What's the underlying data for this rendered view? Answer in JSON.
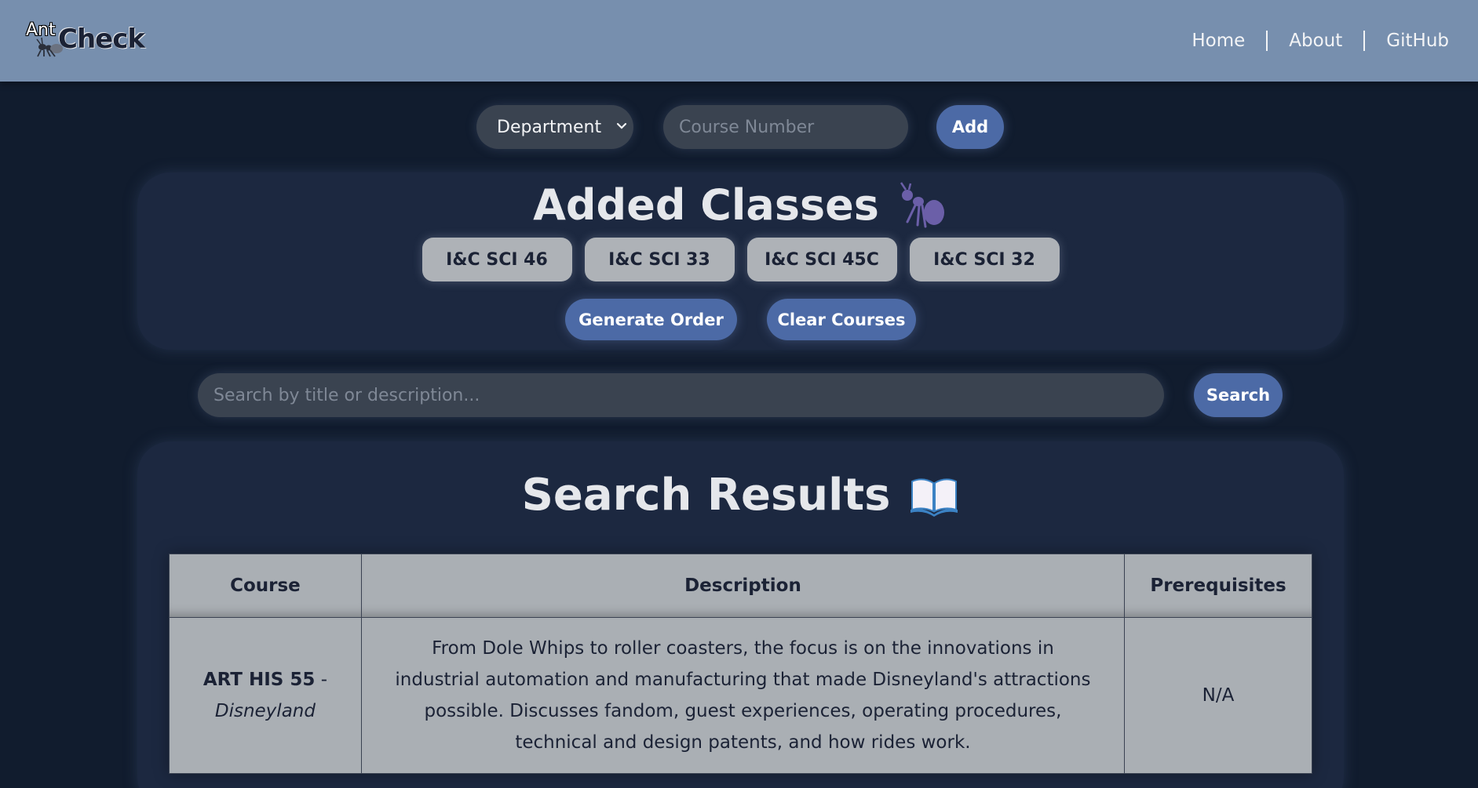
{
  "navbar": {
    "logo": {
      "ant_text": "Ant",
      "check_text": "Check"
    },
    "links": [
      "Home",
      "About",
      "GitHub"
    ]
  },
  "add_course": {
    "department_selected": "Department",
    "course_number_placeholder": "Course Number",
    "add_label": "Add"
  },
  "added_classes": {
    "title": "Added Classes",
    "title_icon": "ant-icon",
    "courses": [
      "I&C SCI 46",
      "I&C SCI 33",
      "I&C SCI 45C",
      "I&C SCI 32"
    ],
    "generate_label": "Generate Order",
    "clear_label": "Clear Courses"
  },
  "search": {
    "placeholder": "Search by title or description...",
    "button_label": "Search"
  },
  "results": {
    "title": "Search Results",
    "title_icon": "open-book-icon",
    "columns": [
      "Course",
      "Description",
      "Prerequisites"
    ],
    "rows": [
      {
        "code": "ART HIS 55",
        "separator": " -",
        "name": "Disneyland",
        "description": "From Dole Whips to roller coasters, the focus is on the innovations in industrial automation and manufacturing that made Disneyland's attractions possible. Discusses fandom, guest experiences, operating procedures, technical and design patents, and how rides work.",
        "prerequisites": "N/A"
      }
    ]
  },
  "colors": {
    "background": "#111c2e",
    "navbar": "#778fae",
    "panel": "#1c2840",
    "accent_button": "#4c6aa6",
    "chip": "#aeb2b7",
    "table": "#aaafb4"
  }
}
